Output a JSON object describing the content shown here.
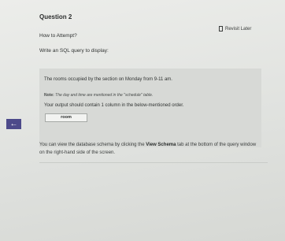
{
  "question": {
    "title": "Question 2",
    "revisit_label": "Revisit Later",
    "how_to_attempt": "How to Attempt?",
    "prompt": "Write an SQL query to display:",
    "description": "The rooms occupied by the section on Monday from 9-11 am.",
    "note_label": "Note:",
    "note_text": "The day and time are mentioned in the \"schedule\" table.",
    "output_instruction": "Your output should contain 1 column in the below-mentioned order.",
    "output_columns": [
      "room"
    ]
  },
  "info": {
    "text_before": "You can view the database schema by clicking the",
    "link_label": "View Schema",
    "text_after": "tab at the bottom of the query window on the right-hand side of the screen."
  },
  "navigation": {
    "back_icon": "left-arrow-icon",
    "back_glyph": "←",
    "accent_color": "#4d4a8a"
  }
}
